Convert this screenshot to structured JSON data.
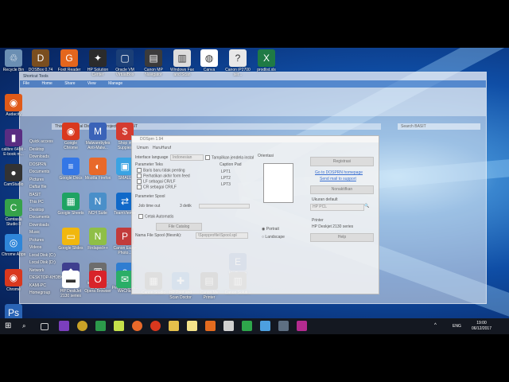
{
  "desktop_icons": [
    {
      "label": "Recycle Bin",
      "color": "#6b8fb3",
      "glyph": "♲"
    },
    {
      "label": "DOSBox 0.74",
      "color": "#7a4e1f",
      "glyph": "D"
    },
    {
      "label": "Foxit Reader",
      "color": "#e4661d",
      "glyph": "G"
    },
    {
      "label": "HP Solution Center",
      "color": "#2b2b2b",
      "glyph": "✦"
    },
    {
      "label": "Oracle VM VirtualBox",
      "color": "#1b3f77",
      "glyph": "▢"
    },
    {
      "label": "Canon MP Navigator",
      "color": "#3b3b3b",
      "glyph": "▤"
    },
    {
      "label": "Windows Fax and Scan",
      "color": "#dddddd",
      "glyph": "▥"
    },
    {
      "label": "Canva",
      "color": "#ffffff",
      "glyph": "◍"
    },
    {
      "label": "Canon iP2700 ser...",
      "color": "#e8e8e8",
      "glyph": "?"
    },
    {
      "label": "prodlist.xls",
      "color": "#1f7a45",
      "glyph": "X"
    }
  ],
  "left_icons": [
    {
      "label": "Audacity",
      "color": "#e05a18",
      "glyph": "◉"
    },
    {
      "label": "calibre 64bit - E-book m...",
      "color": "#5a2d82",
      "glyph": "▮"
    },
    {
      "label": "CamStudio",
      "color": "#333333",
      "glyph": "●"
    },
    {
      "label": "Camtasia Studio 8",
      "color": "#36a24a",
      "glyph": "C"
    },
    {
      "label": "Chrome Apps",
      "color": "#2f86d9",
      "glyph": "◎"
    },
    {
      "label": "Chrome",
      "color": "#d9381e",
      "glyph": "◉"
    },
    {
      "label": "Photoshop - Shortcut",
      "color": "#2a64b5",
      "glyph": "Ps"
    }
  ],
  "grid_icons": [
    {
      "label": "Google Chrome",
      "color": "#d9381e",
      "glyph": "◉"
    },
    {
      "label": "Malwarebytes Anti-Malw...",
      "color": "#3a63b8",
      "glyph": "M"
    },
    {
      "label": "Shop in Suppies",
      "color": "#d43b30",
      "glyph": "$"
    },
    {
      "label": "Google Docs",
      "color": "#3477e6",
      "glyph": "≡"
    },
    {
      "label": "Mozilla Firefox",
      "color": "#e8692a",
      "glyph": "◐"
    },
    {
      "label": "SMALL",
      "color": "#3aa3e3",
      "glyph": "▣"
    },
    {
      "label": "Google Sheets",
      "color": "#1fa363",
      "glyph": "▦"
    },
    {
      "label": "NCH Suite",
      "color": "#4a8fc9",
      "glyph": "N"
    },
    {
      "label": "TeamViewer",
      "color": "#1069c9",
      "glyph": "⇄"
    },
    {
      "label": "Google Slides",
      "color": "#f1b70e",
      "glyph": "▭"
    },
    {
      "label": "Firdaped++",
      "color": "#8fbf47",
      "glyph": "N"
    },
    {
      "label": "Canon Easy-Photo...",
      "color": "#c23b3b",
      "glyph": "P"
    },
    {
      "label": "Identat",
      "color": "#3f3f8f",
      "glyph": "◆"
    },
    {
      "label": "inecapFi... - Shortcut",
      "color": "#6d6d6d",
      "glyph": "▣"
    },
    {
      "label": "e-SPT Pemotongan...",
      "color": "#2f7dd1",
      "glyph": "e"
    },
    {
      "label": "My Epson Portal",
      "color": "#2a5ba8",
      "glyph": "E"
    },
    {
      "label": "HP DeskJet 2130 series",
      "color": "#ffffff",
      "glyph": "▬"
    },
    {
      "label": "Opera Browser",
      "color": "#d8232a",
      "glyph": "O"
    },
    {
      "label": "WeChat",
      "color": "#2aae67",
      "glyph": "✉"
    },
    {
      "label": "Canon Studio",
      "color": "#555555",
      "glyph": "▦"
    },
    {
      "label": "HP Print and Scan Doctor",
      "color": "#1b6fc4",
      "glyph": "✚"
    },
    {
      "label": "Canon My Printer",
      "color": "#444444",
      "glyph": "▤"
    },
    {
      "label": "Canon Soluti...",
      "color": "#777777",
      "glyph": "▥"
    }
  ],
  "explorer": {
    "title": "Shortcut Tools",
    "tabs": [
      "File",
      "Home",
      "Share",
      "View",
      "Manage"
    ],
    "address": "This PC > Local Disk (D:) > Project all > BASIT",
    "search_placeholder": "Search BASIT",
    "nav": [
      "Quick access",
      "Desktop",
      "Downloads",
      "DOSPRN",
      "Documents",
      "Pictures",
      "Daftar file",
      "BASIT",
      "This PC",
      "Desktop",
      "Documents",
      "Downloads",
      "Music",
      "Pictures",
      "Videos",
      "Local Disk (C:)",
      "Local Disk (D:)",
      "Network",
      "DESKTOP-KHDBK",
      "KAMI-PC",
      "Homegroup"
    ]
  },
  "dialog": {
    "title": "DOSprn 1.94",
    "tabs": [
      "Umum",
      "HuruHuruf"
    ],
    "interface_label": "Interface language",
    "interface_value": "Indonesian",
    "show_label": "Tampilkan jendela instal",
    "form_params": "Parameter Teks",
    "opts": [
      "Baris baru tidak penting",
      "Perhatikan akhir form feed",
      "LF sebagai CR/LF",
      "CR sebagai CR/LF"
    ],
    "caret_label": "Caption Pad",
    "lpt": [
      "LPT1",
      "LPT2",
      "LPT3"
    ],
    "spool": "Parameter Spool",
    "timeout_label": "Job time out",
    "timeout_value": "3 detik",
    "auto_print": "Cetak Automatis",
    "file_catalog": "File Catalog",
    "spool_name_label": "Nama File Spool (filesnik):",
    "spool_name_value": "\\Spopprofile\\Spool.spl",
    "preview_label": "Orientasi",
    "portrait": "Portrait",
    "landscape": "Landscape",
    "register": "Registrasi",
    "home_link": "Go to DOSPRN homepage",
    "email_link": "Send mail to support",
    "nonaktif": "Nonaktifkan",
    "printer_label": "Ukuran default",
    "printer_value": "HP PCL",
    "printer_name_label": "Printer",
    "printer_name": "HP Deskjet 2130 series",
    "help": "Help"
  },
  "clock": {
    "time": "19:00",
    "date": "06/12/2017"
  },
  "language": "ENG"
}
